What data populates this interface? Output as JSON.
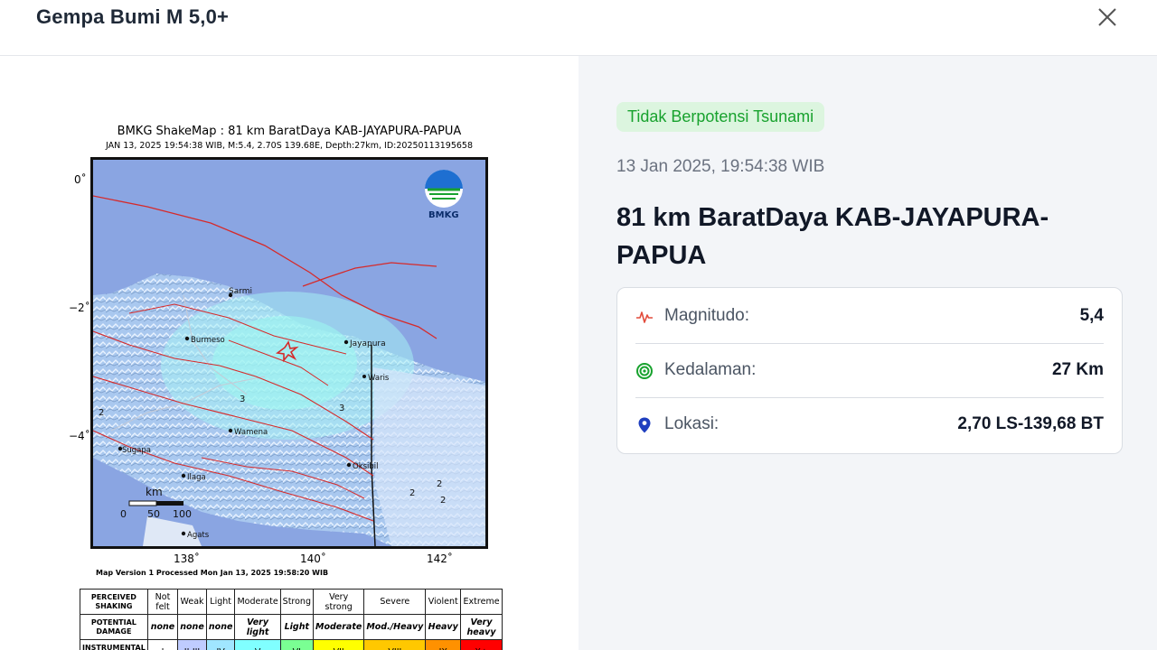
{
  "dialog": {
    "title": "Gempa Bumi M 5,0+",
    "close_icon": "close-icon"
  },
  "shakemap": {
    "title": "BMKG ShakeMap : 81 km BaratDaya KAB-JAYAPURA-PAPUA",
    "subtitle": "JAN 13, 2025 19:54:38 WIB, M:5.4, 2.70S 139.68E, Depth:27km, ID:20250113195658",
    "logo_text": "BMKG",
    "lat_labels": [
      "0˚",
      "−2˚",
      "−4˚"
    ],
    "lon_labels": [
      "138˚",
      "140˚",
      "142˚"
    ],
    "places": [
      "Sarmi",
      "Jayapura",
      "Burmeso",
      "Waris",
      "Wamena",
      "Sugapa",
      "Ilaga",
      "Oksibil",
      "Agats"
    ],
    "intensity_marks": [
      "3",
      "2",
      "3",
      "2",
      "2",
      "2"
    ],
    "scale_label": "km",
    "scale_ticks": [
      "0",
      "50",
      "100"
    ],
    "version_text": "Map Version 1 Processed Mon Jan 13, 2025 19:58:20 WIB",
    "legend": {
      "row1_header": "PERCEIVED SHAKING",
      "row1": [
        "Not felt",
        "Weak",
        "Light",
        "Moderate",
        "Strong",
        "Very strong",
        "Severe",
        "Violent",
        "Extreme"
      ],
      "row2_header": "POTENTIAL DAMAGE",
      "row2": [
        "none",
        "none",
        "none",
        "Very light",
        "Light",
        "Moderate",
        "Mod./Heavy",
        "Heavy",
        "Very heavy"
      ],
      "row3_header": "INSTRUMENTAL INTENSITY",
      "row3": [
        "I",
        "II-III",
        "IV",
        "V",
        "VI",
        "VII",
        "VIII",
        "IX",
        "X+"
      ],
      "colors": [
        "#ffffff",
        "#bfccff",
        "#a0e6ff",
        "#80ffff",
        "#7aff93",
        "#ffff00",
        "#ffc800",
        "#ff9100",
        "#ff0000"
      ]
    }
  },
  "info": {
    "tsunami_badge": "Tidak Berpotensi Tsunami",
    "datetime": "13 Jan 2025, 19:54:38 WIB",
    "location_title": "81 km BaratDaya KAB-JAYAPURA-PAPUA",
    "rows": [
      {
        "label": "Magnitudo:",
        "value": "5,4",
        "icon": "pulse-icon"
      },
      {
        "label": "Kedalaman:",
        "value": "27 Km",
        "icon": "target-icon"
      },
      {
        "label": "Lokasi:",
        "value": "2,70 LS-139,68 BT",
        "icon": "location-pin-icon"
      }
    ],
    "accent_green": "#18a22e",
    "badge_bg": "#dcf5df"
  }
}
